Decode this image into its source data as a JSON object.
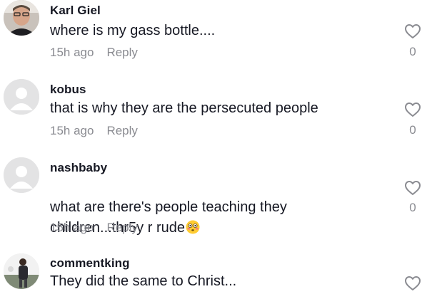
{
  "comments": [
    {
      "username": "Karl Giel",
      "text": "where is my gass bottle....",
      "time": "15h ago",
      "reply_label": "Reply",
      "like_count": "0",
      "avatar": "photo"
    },
    {
      "username": "kobus",
      "text": "that is why they are the persecuted people",
      "time": "15h ago",
      "reply_label": "Reply",
      "like_count": "0",
      "avatar": "default"
    },
    {
      "username": "nashbaby",
      "text": "what are there's people teaching they\nchildren...thr5y r rude",
      "emoji": "flushed-face",
      "time": "15h ago",
      "reply_label": "Reply",
      "like_count": "0",
      "avatar": "default"
    },
    {
      "username": "commentking",
      "text": "They did the same to Christ...",
      "avatar": "photo"
    }
  ],
  "icons": {
    "like": "heart-outline-icon",
    "avatar_default": "default-avatar-icon"
  },
  "colors": {
    "username": "#161823",
    "body_text": "#161823",
    "secondary": "#8a8b91",
    "avatar_bg": "#e3e3e4",
    "avatar_silhouette": "#ffffff"
  }
}
